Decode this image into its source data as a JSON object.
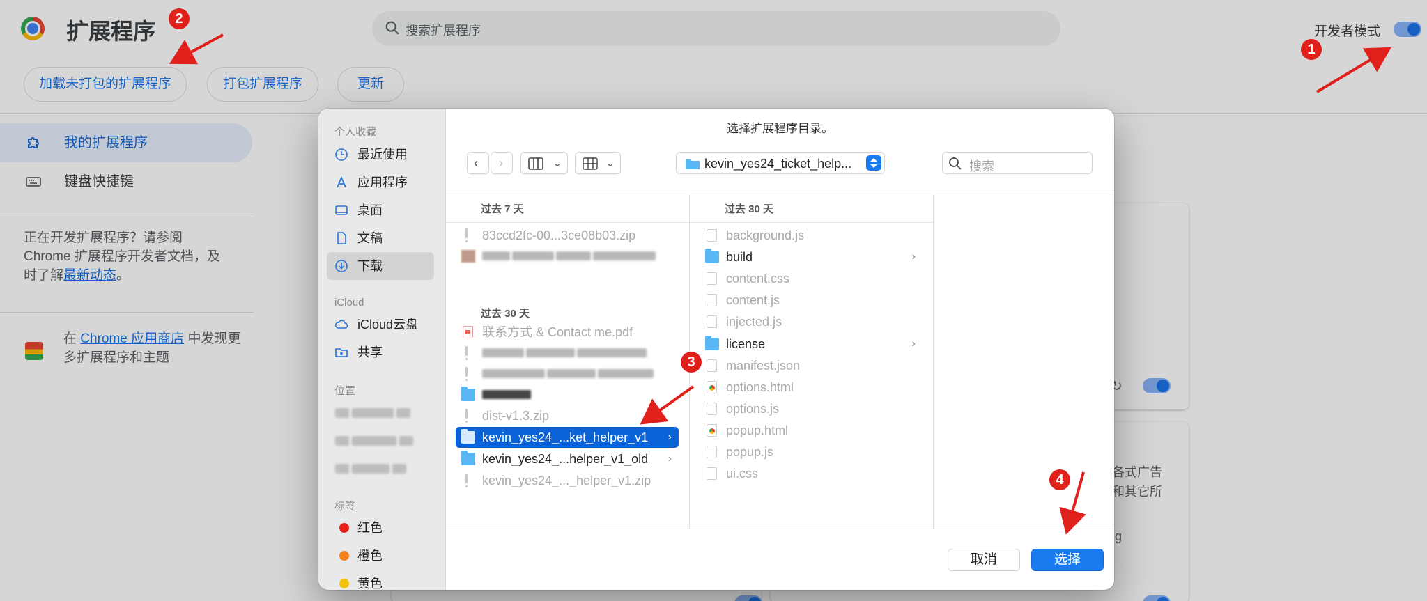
{
  "header": {
    "title": "扩展程序",
    "search_placeholder": "搜索扩展程序",
    "dev_mode_label": "开发者模式"
  },
  "toolbar": {
    "load_unpacked": "加载未打包的扩展程序",
    "pack": "打包扩展程序",
    "update": "更新"
  },
  "sidebar": {
    "my_extensions": "我的扩展程序",
    "keyboard_shortcuts": "键盘快捷键",
    "dev_text": "正在开发扩展程序？请参阅 Chrome 扩展程序开发者文档，及时了解",
    "dev_link": "最新动态",
    "dev_end": "。",
    "store_prefix": "在",
    "store_link": "Chrome 应用商店",
    "store_suffix": "中发现更多扩展程序和主题"
  },
  "card_fragments": {
    "frag1": "各式广告",
    "frag2": "和其它所",
    "frag3": "lg"
  },
  "dialog": {
    "title": "选择扩展程序目录。",
    "path": "kevin_yes24_ticket_help...",
    "search_placeholder": "搜索",
    "sidebar": {
      "favorites_header": "个人收藏",
      "favorites": [
        "最近使用",
        "应用程序",
        "桌面",
        "文稿",
        "下载"
      ],
      "icloud_header": "iCloud",
      "icloud": [
        "iCloud云盘",
        "共享"
      ],
      "locations_header": "位置",
      "tags_header": "标签",
      "tags": [
        {
          "label": "红色",
          "color": "#e8221b"
        },
        {
          "label": "橙色",
          "color": "#f5821f"
        },
        {
          "label": "黄色",
          "color": "#f4c20d"
        }
      ]
    },
    "col1": {
      "header_7": "过去 7 天",
      "header_30": "过去 30 天",
      "file_top": "83ccd2fc-00...3ce08b03.zip",
      "pdf": "联系方式 & Contact me.pdf",
      "dist": "dist-v1.3.zip",
      "selected": "kevin_yes24_...ket_helper_v1",
      "old": "kevin_yes24_...helper_v1_old",
      "zip": "kevin_yes24_..._helper_v1.zip"
    },
    "col2": {
      "header": "过去 30 天",
      "files": [
        "background.js",
        "build",
        "content.css",
        "content.js",
        "injected.js",
        "license",
        "manifest.json",
        "options.html",
        "options.js",
        "popup.html",
        "popup.js",
        "ui.css"
      ]
    },
    "cancel": "取消",
    "choose": "选择"
  },
  "annotations": [
    "1",
    "2",
    "3",
    "4"
  ]
}
